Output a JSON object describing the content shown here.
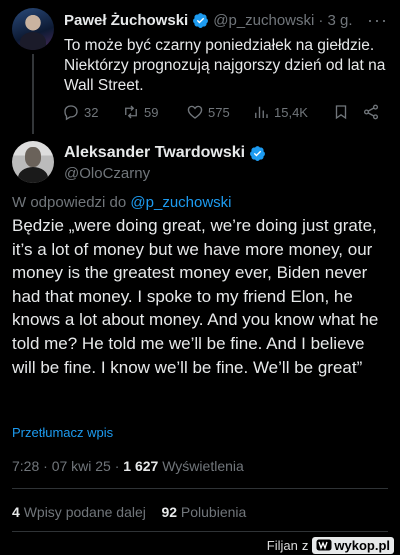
{
  "parent_post": {
    "name": "Paweł Żuchowski",
    "handle": "@p_zuchowski",
    "time": "· 3 g.",
    "more": "···",
    "text": "To może być czarny poniedziałek na giełdzie. Niektórzy prognozują najgorszy dzień od lat na Wall Street.",
    "actions": {
      "replies": "32",
      "reposts": "59",
      "likes": "575",
      "views": "15,4K"
    }
  },
  "post": {
    "name": "Aleksander Twardowski",
    "handle": "@OloCzarny",
    "reply_prefix": "W odpowiedzi do",
    "reply_handle": "@p_zuchowski",
    "text": "Będzie „were doing great, we’re doing just grate, it’s a lot of money but we have more money, our money is the greatest money ever, Biden never had that money.   I spoke to my friend Elon, he knows a lot about money. And you know what he told me? He told me we’ll be fine. And I believe will be fine. I know we’ll be fine. We’ll be great”",
    "translate": "Przetłumacz wpis",
    "time": "7:28 · 07 kwi 25 · ",
    "views_count": "1 627",
    "views_label": "Wyświetlenia",
    "reposts_count": "4",
    "reposts_label": "Wpisy podane dalej",
    "likes_count": "92",
    "likes_label": "Polubienia"
  },
  "watermark": {
    "user": "Filjan",
    "sep": "z",
    "brand": "wykop.pl"
  },
  "colors": {
    "accent": "#1d9bf0",
    "muted": "#71767b",
    "text": "#e7e9ea",
    "bg": "#000000"
  }
}
